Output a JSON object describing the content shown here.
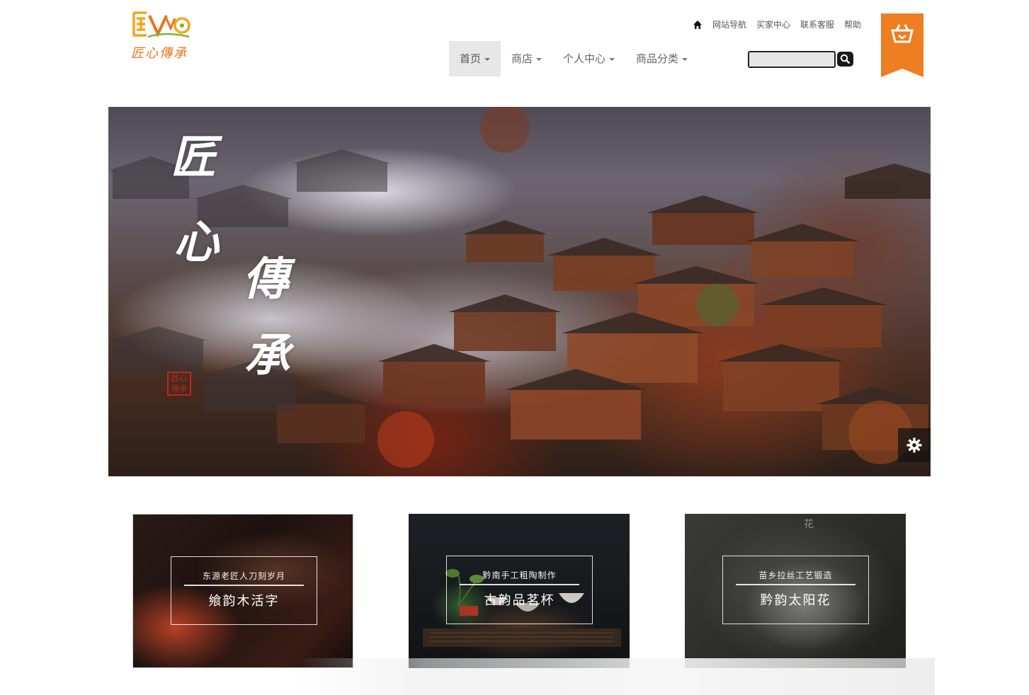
{
  "header": {
    "logo_text": "匠心傳承",
    "logo_mark_text": "匠心",
    "top_links": [
      "网站导航",
      "买家中心",
      "联系客服",
      "帮助"
    ],
    "nav": [
      {
        "label": "首页",
        "active": true
      },
      {
        "label": "商店",
        "active": false
      },
      {
        "label": "个人中心",
        "active": false
      },
      {
        "label": "商品分类",
        "active": false
      }
    ],
    "search": {
      "placeholder": "",
      "value": ""
    },
    "cart_color": "#ef7d22"
  },
  "hero": {
    "calligraphy": [
      "匠",
      "心",
      "傳",
      "承"
    ],
    "seal_text": "匠心\n傳承"
  },
  "cards": [
    {
      "subtitle": "东源老匠人刀刻岁月",
      "title": "飨韵木活字"
    },
    {
      "subtitle": "黔南手工粗陶制作",
      "title": "古韵品茗杯"
    },
    {
      "subtitle": "苗乡拉丝工艺锻造",
      "title": "黔韵太阳花",
      "deco": "花"
    }
  ],
  "icons": {
    "home": "home-icon",
    "search": "search-icon",
    "cart": "shopping-basket-icon",
    "gear": "gear-icon"
  }
}
